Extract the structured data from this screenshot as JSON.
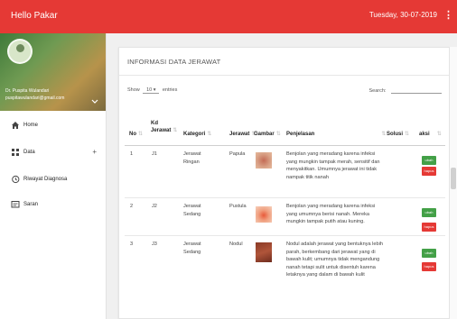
{
  "topbar": {
    "title": "Hello Pakar",
    "date": "Tuesday, 30-07-2019",
    "menu_icon": "⋮"
  },
  "sidebar": {
    "user_name": "Dr. Puspita Wulandari",
    "user_email": "puspitawulandari@gmail.com",
    "items": [
      {
        "label": "Home",
        "icon": "home-icon"
      },
      {
        "label": "Data",
        "icon": "grid-icon"
      },
      {
        "label": "Riwayat Diagnosa",
        "icon": "history-icon"
      },
      {
        "label": "Saran",
        "icon": "message-icon"
      }
    ]
  },
  "main": {
    "title": "INFORMASI DATA JERAWAT",
    "show_label": "Show",
    "show_value": "10",
    "entries_label": "entries",
    "search_label": "Search:",
    "columns": [
      "No",
      "Kd Jerawat",
      "Kategori",
      "Jerawat",
      "Gambar",
      "Penjelasan",
      "Solusi",
      "aksi"
    ],
    "action_edit": "ubah",
    "action_delete": "hapus",
    "rows": [
      {
        "no": "1",
        "kd": "J1",
        "kategori": "Jerawat Ringan",
        "jerawat": "Papula",
        "penjelasan": "Benjolan yang meradang karena infeksi yang mungkin tampak merah, sensitif dan menyakitkan. Umumnya jerawat ini tidak nampak titik nanah"
      },
      {
        "no": "2",
        "kd": "J2",
        "kategori": "Jerawat Sedang",
        "jerawat": "Pustula",
        "penjelasan": "Benjolan yang meradang karena infeksi yang umumnya berisi nanah. Mereka mungkin tampak putih atau kuning."
      },
      {
        "no": "3",
        "kd": "J3",
        "kategori": "Jerawat Sedang",
        "jerawat": "Nodul",
        "penjelasan": "Nodul adalah jerawat yang bentuknya lebih parah, berkembang dari jerawat yang di bawah kulit; umumnya tidak mengandung nanah tetapi sulit untuk disentuh karena letaknya yang dalam di bawah kulit"
      }
    ]
  },
  "colors": {
    "accent": "#e53935",
    "edit": "#43a047",
    "delete": "#e53935"
  }
}
